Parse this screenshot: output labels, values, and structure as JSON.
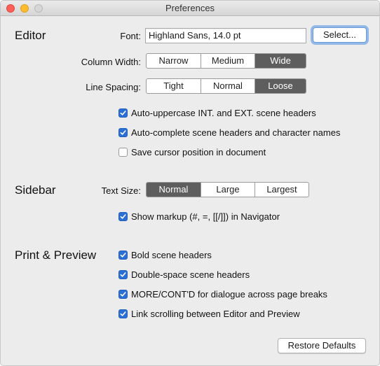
{
  "window": {
    "title": "Preferences"
  },
  "editor": {
    "section_title": "Editor",
    "font_label": "Font:",
    "font_value": "Highland Sans, 14.0 pt",
    "select_button": "Select...",
    "column_width_label": "Column Width:",
    "column_width_options": [
      "Narrow",
      "Medium",
      "Wide"
    ],
    "column_width_selected": "Wide",
    "line_spacing_label": "Line Spacing:",
    "line_spacing_options": [
      "Tight",
      "Normal",
      "Loose"
    ],
    "line_spacing_selected": "Loose",
    "checkboxes": [
      {
        "label": "Auto-uppercase INT. and EXT. scene headers",
        "checked": true
      },
      {
        "label": "Auto-complete scene headers and character names",
        "checked": true
      },
      {
        "label": "Save cursor position in document",
        "checked": false
      }
    ]
  },
  "sidebar": {
    "section_title": "Sidebar",
    "text_size_label": "Text Size:",
    "text_size_options": [
      "Normal",
      "Large",
      "Largest"
    ],
    "text_size_selected": "Normal",
    "checkboxes": [
      {
        "label": "Show markup (#, =, [[/]]) in Navigator",
        "checked": true
      }
    ]
  },
  "print_preview": {
    "section_title": "Print & Preview",
    "checkboxes": [
      {
        "label": "Bold scene headers",
        "checked": true
      },
      {
        "label": "Double-space scene headers",
        "checked": true
      },
      {
        "label": "MORE/CONT'D for dialogue across page breaks",
        "checked": true
      },
      {
        "label": "Link scrolling between Editor and Preview",
        "checked": true
      }
    ]
  },
  "footer": {
    "restore_button": "Restore Defaults"
  },
  "colors": {
    "accent": "#2b6fd5",
    "segment_selected": "#5e5e5e",
    "window_bg": "#ececec"
  }
}
